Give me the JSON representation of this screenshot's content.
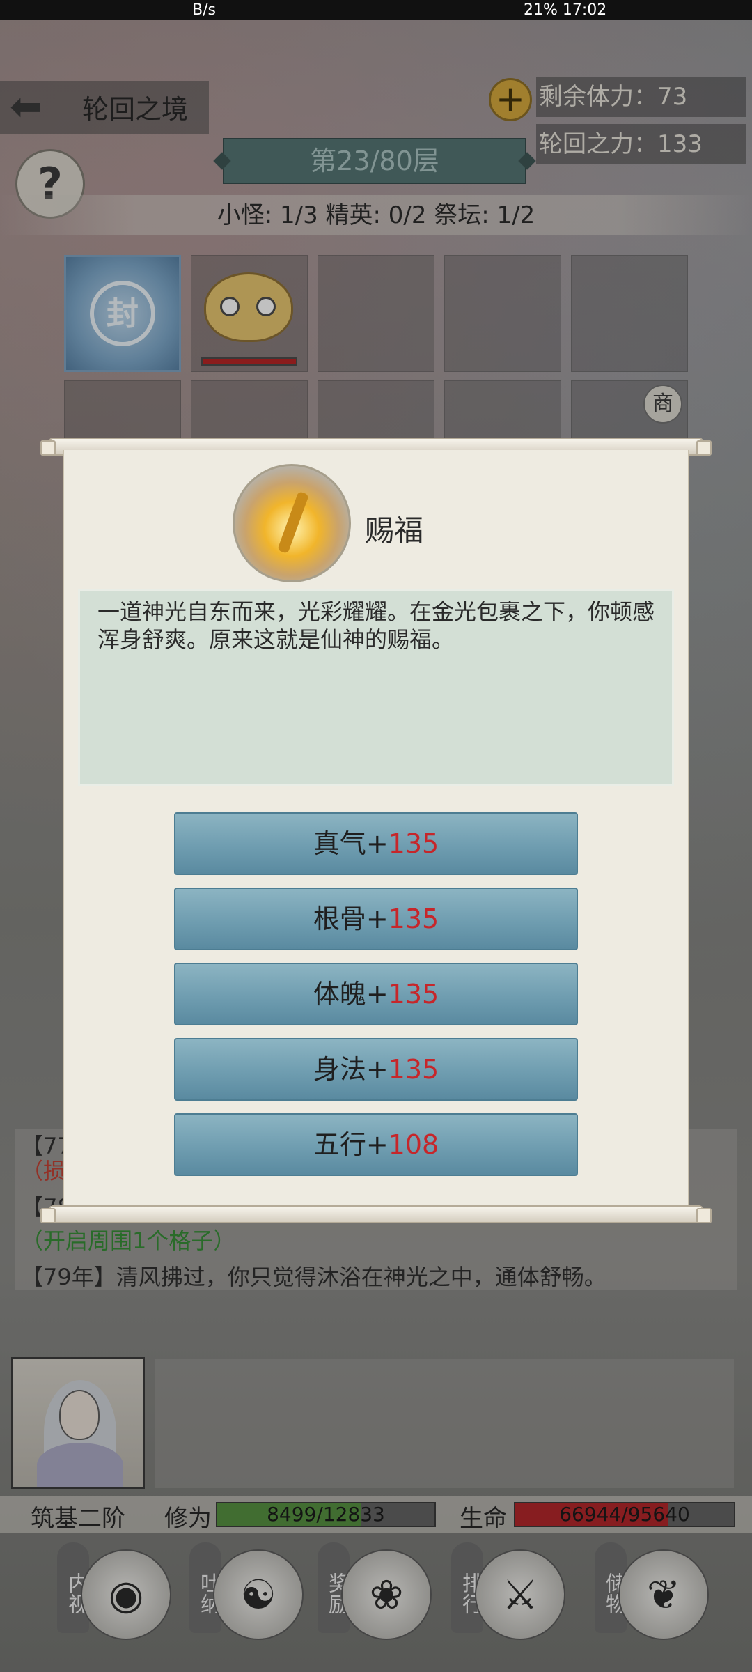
{
  "status_bar": {
    "left": "B/s",
    "right": "21%  17:02"
  },
  "header": {
    "back_label": "轮回之境",
    "help_symbol": "?",
    "plus_symbol": "+",
    "stamina_label": "剩余体力：",
    "stamina_value": "73",
    "power_label": "轮回之力：",
    "power_value": "133",
    "floor": "第23/80层",
    "enemy_counts": "小怪: 1/3 精英: 0/2 祭坛: 1/2"
  },
  "grid": {
    "seal_glyph": "封",
    "shop_badge": "商"
  },
  "dialog": {
    "title": "赐福",
    "description": "一道神光自东而来，光彩耀耀。在金光包裹之下，你顿感浑身舒爽。原来这就是仙神的赐福。",
    "options": [
      {
        "label": "真气+",
        "value": "135"
      },
      {
        "label": "根骨+",
        "value": "135"
      },
      {
        "label": "体魄+",
        "value": "135"
      },
      {
        "label": "身法+",
        "value": "135"
      },
      {
        "label": "五行+",
        "value": "108"
      }
    ]
  },
  "log": {
    "line1": "【77",
    "line2": "（损",
    "line3": "【78",
    "line4": "（开启周围1个格子）",
    "line5": "【79年】清风拂过，你只觉得沐浴在神光之中，通体舒畅。"
  },
  "player": {
    "realm": "筑基二阶",
    "cultivation_label": "修为",
    "cultivation": "8499/12833",
    "cultivation_ratio": 0.662,
    "life_label": "生命",
    "life": "66944/95640",
    "life_ratio": 0.7
  },
  "nav": [
    {
      "label": "内视",
      "icon": "eye-icon"
    },
    {
      "label": "吐纳",
      "icon": "meditation-icon"
    },
    {
      "label": "奖励",
      "icon": "gift-icon"
    },
    {
      "label": "排行",
      "icon": "ranking-icon"
    },
    {
      "label": "储物",
      "icon": "bag-icon"
    }
  ],
  "colors": {
    "option_value": "#c6262a",
    "cultivation_bar": "#4f8d3a",
    "life_bar": "#b01e22"
  }
}
